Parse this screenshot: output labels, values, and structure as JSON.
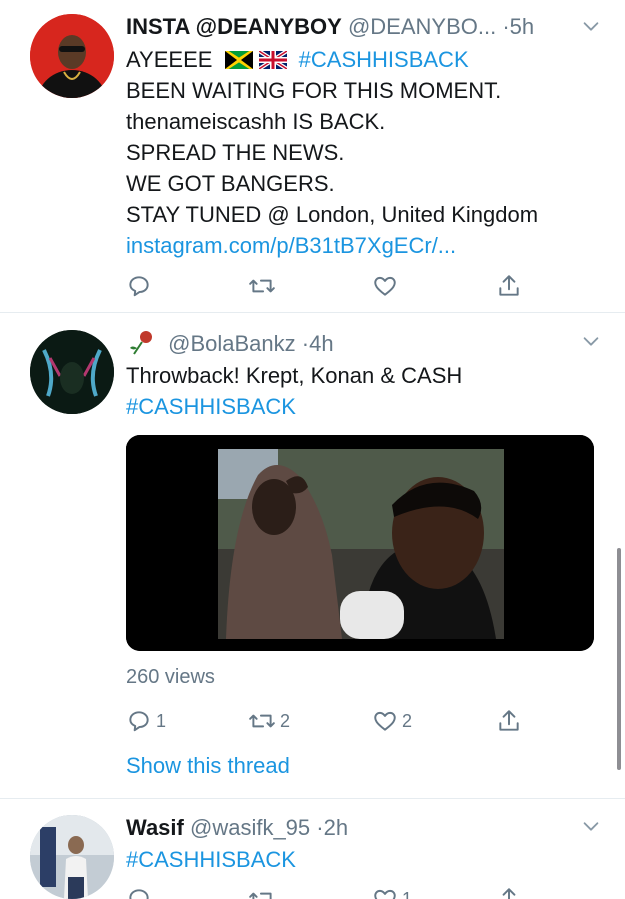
{
  "tweets": [
    {
      "name": "INSTA @DEANYBOY",
      "handle": "@DEANYBO...",
      "separator": "·",
      "time": "5h",
      "line1_prefix": "AYEEEE",
      "line1_hashtag": "#CASHHISBACK",
      "lines": [
        "BEEN WAITING FOR THIS MOMENT.",
        "thenameiscashh IS BACK.",
        "SPREAD THE NEWS.",
        "WE GOT BANGERS.",
        "STAY TUNED @ London, United Kingdom"
      ],
      "link": "instagram.com/p/B31tB7XgECr/...",
      "actions": {
        "reply": "",
        "retweet": "",
        "like": ""
      }
    },
    {
      "handle": "@BolaBankz",
      "separator": "·",
      "time": "4h",
      "text": "Throwback! Krept, Konan & CASH",
      "hashtag": "#CASHHISBACK",
      "views": "260 views",
      "actions": {
        "reply": "1",
        "retweet": "2",
        "like": "2"
      },
      "show_thread": "Show this thread"
    },
    {
      "name": "Wasif",
      "handle": "@wasifk_95",
      "separator": "·",
      "time": "2h",
      "hashtag": "#CASHHISBACK",
      "actions": {
        "like": "1"
      }
    }
  ],
  "icons": {
    "reply": "reply-icon",
    "retweet": "retweet-icon",
    "like": "heart-icon",
    "share": "share-icon",
    "menu": "chevron-down-icon"
  },
  "colors": {
    "link": "#1b95e0",
    "secondary": "#657786",
    "divider": "#e6ecf0"
  }
}
